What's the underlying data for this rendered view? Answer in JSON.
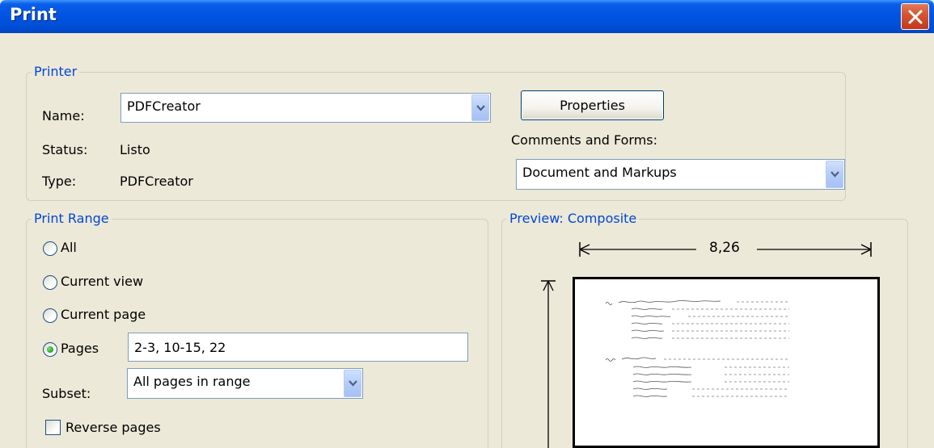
{
  "window": {
    "title": "Print"
  },
  "printer": {
    "legend": "Printer",
    "name_label": "Name:",
    "name_value": "PDFCreator",
    "status_label": "Status:",
    "status_value": "Listo",
    "type_label": "Type:",
    "type_value": "PDFCreator",
    "properties_button": "Properties",
    "comments_label": "Comments and Forms:",
    "comments_value": "Document and Markups"
  },
  "print_range": {
    "legend": "Print Range",
    "options": [
      {
        "label": "All",
        "checked": false
      },
      {
        "label": "Current view",
        "checked": false
      },
      {
        "label": "Current page",
        "checked": false
      },
      {
        "label": "Pages",
        "checked": true
      }
    ],
    "pages_value": "2-3, 10-15, 22",
    "subset_label": "Subset:",
    "subset_value": "All pages in range",
    "reverse_label": "Reverse pages"
  },
  "preview": {
    "legend": "Preview: Composite",
    "width_value": "8,26"
  },
  "colors": {
    "titlebar": "#0054e3",
    "legend_text": "#0046d5",
    "dialog_bg": "#ece9d8"
  }
}
